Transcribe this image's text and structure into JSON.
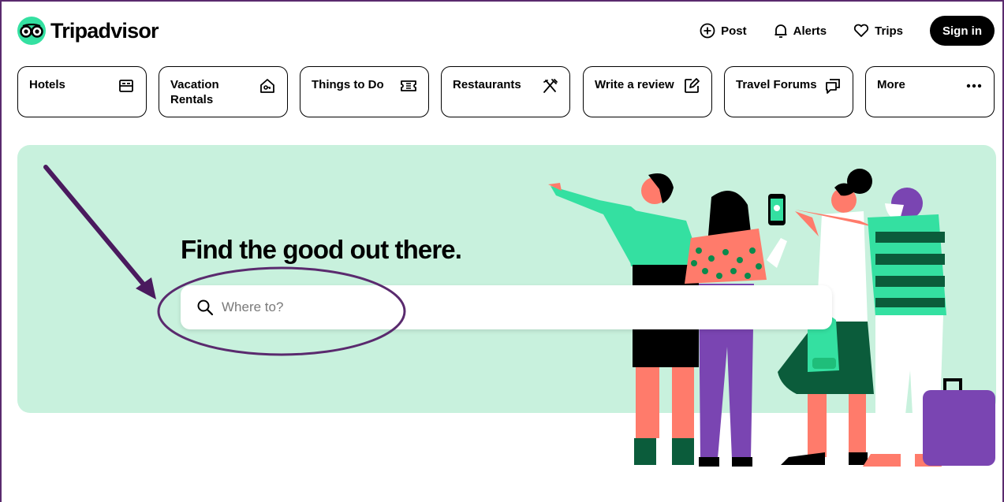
{
  "brand": {
    "name": "Tripadvisor"
  },
  "top_nav": {
    "post": "Post",
    "alerts": "Alerts",
    "trips": "Trips",
    "sign_in": "Sign in"
  },
  "categories": [
    {
      "label": "Hotels",
      "icon": "bed-icon"
    },
    {
      "label": "Vacation Rentals",
      "icon": "house-key-icon"
    },
    {
      "label": "Things to Do",
      "icon": "ticket-icon"
    },
    {
      "label": "Restaurants",
      "icon": "fork-knife-icon"
    },
    {
      "label": "Write a review",
      "icon": "edit-icon"
    },
    {
      "label": "Travel Forums",
      "icon": "chat-bubble-icon"
    },
    {
      "label": "More",
      "icon": "more-dots-icon"
    }
  ],
  "hero": {
    "headline": "Find the good out there.",
    "search_placeholder": "Where to?"
  },
  "colors": {
    "brand_green": "#34e0a1",
    "hero_bg": "#c8f1dd",
    "annotation": "#4a1a5e"
  }
}
